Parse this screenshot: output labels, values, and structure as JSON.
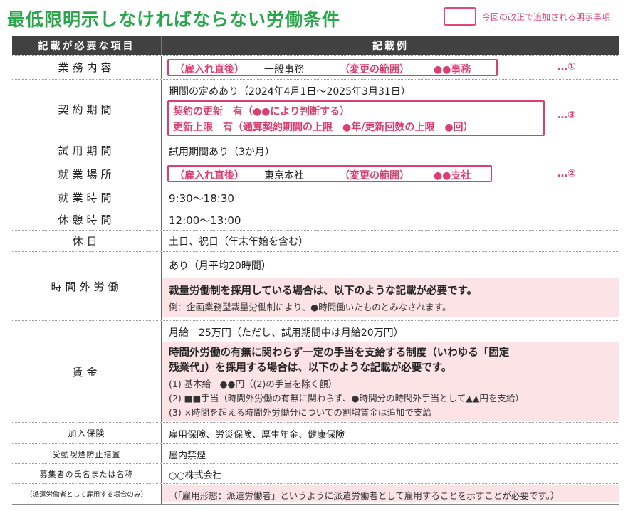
{
  "title": "最低限明示しなければならない労働条件",
  "legend": {
    "label": "今回の改正で追加される明示事項"
  },
  "table": {
    "header": {
      "item": "記載が必要な項目",
      "example": "記載例"
    },
    "rows": {
      "gyomu": {
        "label": "業務内容",
        "box": {
          "a": "（雇入れ直後）",
          "b": "一般事務",
          "c": "（変更の範囲）",
          "d": "●●事務"
        },
        "note": "…①"
      },
      "keiyaku": {
        "label": "契約期間",
        "line1": "期間の定めあり（2024年4月1日～2025年3月31日）",
        "box1": "契約の更新　有（●●により判断する）",
        "box2": "更新上限　有（通算契約期間の上限　●年/更新回数の上限　●回）",
        "note": "…③"
      },
      "shiyo": {
        "label": "試用期間",
        "value": "試用期間あり（3か月）"
      },
      "basho": {
        "label": "就業場所",
        "box": {
          "a": "（雇入れ直後）",
          "b": "東京本社",
          "c": "（変更の範囲）",
          "d": "●●支社"
        },
        "note": "…②"
      },
      "jikan": {
        "label": "就業時間",
        "value": "9:30～18:30"
      },
      "kyukei": {
        "label": "休憩時間",
        "value": "12:00～13:00"
      },
      "kyujitsu": {
        "label": "休日",
        "value": "土日、祝日（年末年始を含む）"
      },
      "jikangai": {
        "label": "時間外労働",
        "line1": "あり（月平均20時間）",
        "pink1": "裁量労働制を採用している場合は、以下のような記載が必要です。",
        "ex_prefix": "例",
        "ex_colon": "：",
        "ex_text": "企画業務型裁量労働制により、●時間働いたものとみなされます。"
      },
      "chingin": {
        "label": "賃金",
        "line1": "月給　25万円（ただし、試用期間中は月給20万円）",
        "pink1": "時間外労働の有無に関わらず一定の手当を支給する制度（いわゆる「固定",
        "pink2": "残業代」）を採用する場合は、以下のような記載が必要です。",
        "p1": "(1) 基本給　●●円（(2)の手当を除く額）",
        "p2": "(2) ■■手当（時間外労働の有無に関わらず、●時間分の時間外手当として▲▲円を支給）",
        "p3": "(3) ×時間を超える時間外労働分についての割増賃金は追加で支給"
      },
      "kanyu": {
        "label": "加入保険",
        "value": "雇用保険、労災保険、厚生年金、健康保険"
      },
      "kitsuen": {
        "label": "受動喫煙防止措置",
        "value": "屋内禁煙"
      },
      "boshusha": {
        "label": "募集者の氏名または名称",
        "value": "○○株式会社"
      },
      "haken": {
        "label": "（派遣労働者として雇用する場合のみ）",
        "value": "（「雇用形態：派遣労働者」というように派遣労働者として雇用することを示すことが必要です。）"
      }
    }
  }
}
